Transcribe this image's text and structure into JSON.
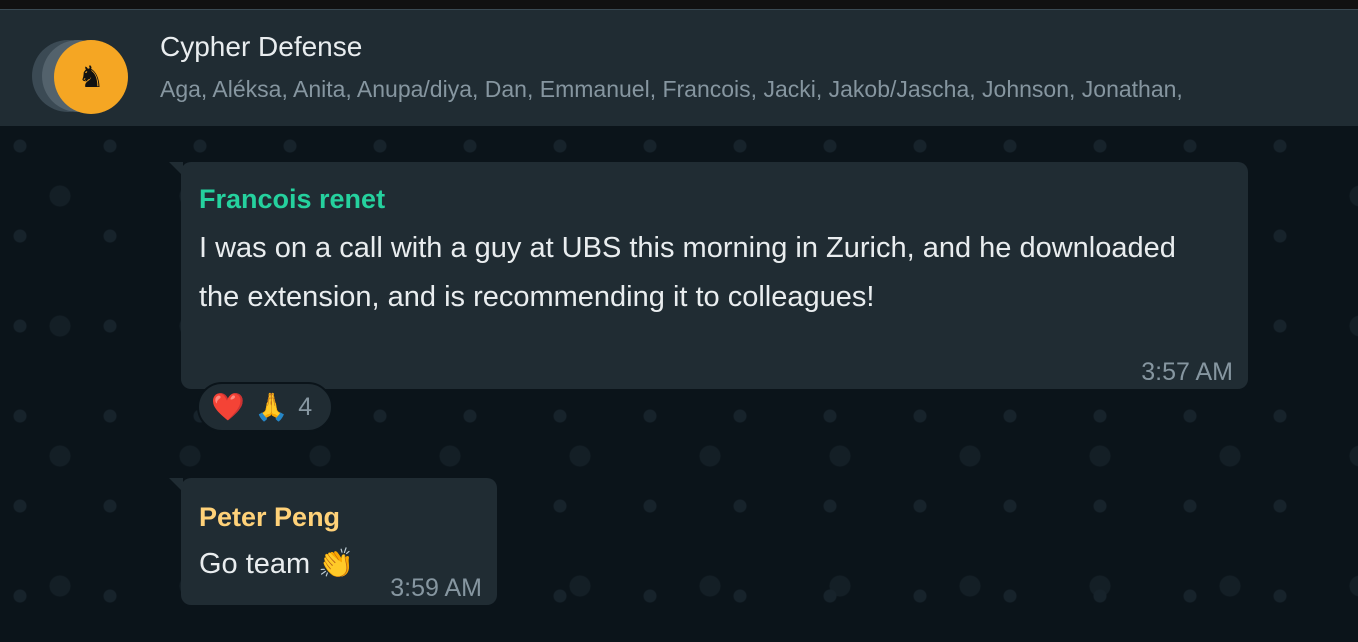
{
  "header": {
    "title": "Cypher Defense",
    "members": "Aga, Aléksa, Anita, Anupa/diya, Dan, Emmanuel, Francois, Jacki, Jakob/Jascha, Johnson, Jonathan,",
    "avatar_icon": "group-avatar"
  },
  "messages": [
    {
      "sender": "Francois renet",
      "sender_color": "#25d19e",
      "text": "I was on a call with a guy at UBS this morning in Zurich, and he downloaded the extension, and is recommending it to colleagues!",
      "time": "3:57 AM",
      "reactions": {
        "emojis": [
          "❤️",
          "🙏"
        ],
        "count": "4"
      }
    },
    {
      "sender": "Peter Peng",
      "sender_color": "#ffd279",
      "text": "Go team 👏",
      "time": "3:59 AM"
    }
  ]
}
